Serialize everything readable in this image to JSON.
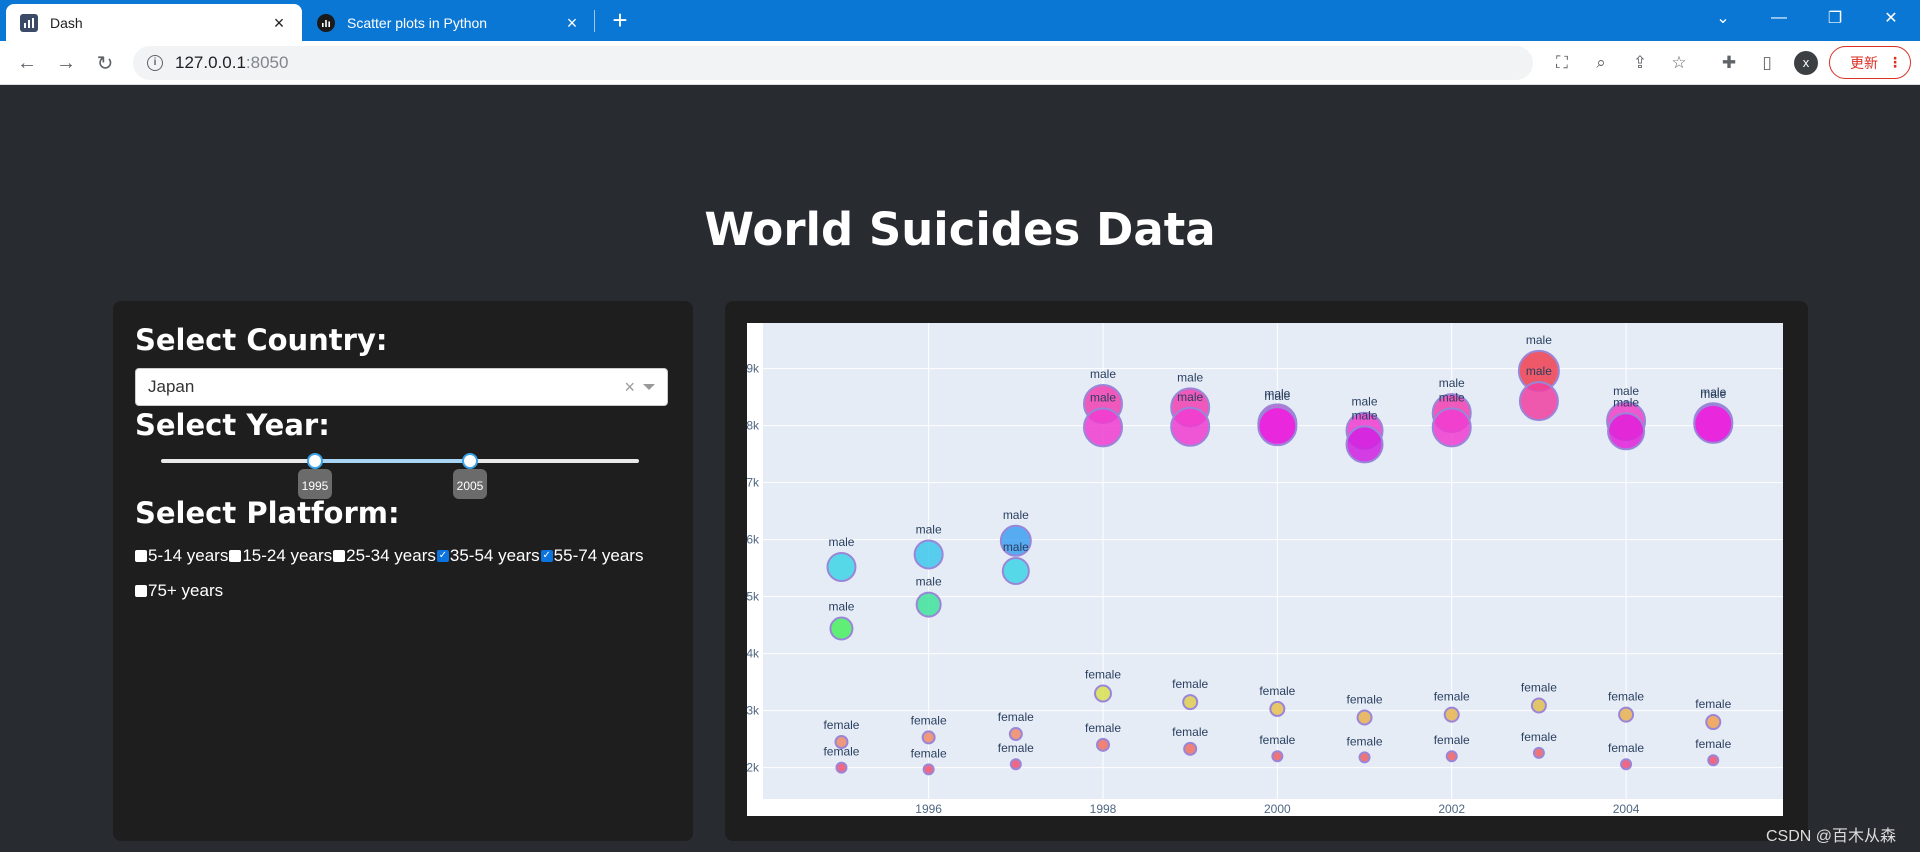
{
  "browser": {
    "tabs": [
      {
        "title": "Dash",
        "active": true
      },
      {
        "title": "Scatter plots in Python",
        "active": false
      }
    ],
    "url_host": "127.0.0.1",
    "url_port": ":8050",
    "profile_initial": "x",
    "update_label": "更新"
  },
  "app": {
    "title": "World Suicides Data",
    "country_label": "Select Country:",
    "country_value": "Japan",
    "year_label": "Select Year:",
    "year_range": [
      1995,
      2005
    ],
    "year_range_labels": [
      "1995",
      "2005"
    ],
    "platform_label": "Select Platform:",
    "age_groups": [
      {
        "label": "5-14 years",
        "checked": false
      },
      {
        "label": "15-24 years",
        "checked": false
      },
      {
        "label": "25-34 years",
        "checked": false
      },
      {
        "label": "35-54 years",
        "checked": true
      },
      {
        "label": "55-74 years",
        "checked": true
      },
      {
        "label": "75+ years",
        "checked": false
      }
    ]
  },
  "chart_data": {
    "type": "scatter",
    "xlim": [
      1994.1,
      2005.8
    ],
    "ylim": [
      1450,
      9800
    ],
    "xticks": [
      1996,
      1998,
      2000,
      2002,
      2004
    ],
    "yticks": [
      2000,
      3000,
      4000,
      5000,
      6000,
      7000,
      8000,
      9000
    ],
    "ytick_labels": [
      "2k",
      "3k",
      "4k",
      "5k",
      "6k",
      "7k",
      "8k",
      "9k"
    ],
    "grid": true,
    "points": [
      {
        "x": 1995,
        "y": 5520,
        "label": "male",
        "r": 14,
        "color": "#3ed5e6"
      },
      {
        "x": 1995,
        "y": 4440,
        "label": "male",
        "r": 11,
        "color": "#48f060"
      },
      {
        "x": 1995,
        "y": 2450,
        "label": "female",
        "r": 6,
        "color": "#f08a66"
      },
      {
        "x": 1995,
        "y": 2000,
        "label": "female",
        "r": 5,
        "color": "#f05070"
      },
      {
        "x": 1996,
        "y": 5740,
        "label": "male",
        "r": 14,
        "color": "#3ec8ec"
      },
      {
        "x": 1996,
        "y": 4860,
        "label": "male",
        "r": 12,
        "color": "#40e39a"
      },
      {
        "x": 1996,
        "y": 2530,
        "label": "female",
        "r": 6,
        "color": "#f08a66"
      },
      {
        "x": 1996,
        "y": 1970,
        "label": "female",
        "r": 5,
        "color": "#f05070"
      },
      {
        "x": 1997,
        "y": 5980,
        "label": "male",
        "r": 15,
        "color": "#3ea0f0"
      },
      {
        "x": 1997,
        "y": 5450,
        "label": "male",
        "r": 13,
        "color": "#3ed5e6"
      },
      {
        "x": 1997,
        "y": 2590,
        "label": "female",
        "r": 6,
        "color": "#f08a66"
      },
      {
        "x": 1997,
        "y": 2060,
        "label": "female",
        "r": 5,
        "color": "#f05070"
      },
      {
        "x": 1998,
        "y": 8380,
        "label": "male",
        "r": 19,
        "color": "#f040b0"
      },
      {
        "x": 1998,
        "y": 7970,
        "label": "male",
        "r": 19,
        "color": "#f03cd0"
      },
      {
        "x": 1998,
        "y": 3300,
        "label": "female",
        "r": 8,
        "color": "#d8e050"
      },
      {
        "x": 1998,
        "y": 2400,
        "label": "female",
        "r": 6,
        "color": "#f07060"
      },
      {
        "x": 1999,
        "y": 8320,
        "label": "male",
        "r": 19,
        "color": "#f040b0"
      },
      {
        "x": 1999,
        "y": 7980,
        "label": "male",
        "r": 19,
        "color": "#f03cd0"
      },
      {
        "x": 1999,
        "y": 3150,
        "label": "female",
        "r": 7,
        "color": "#e0cc50"
      },
      {
        "x": 1999,
        "y": 2330,
        "label": "female",
        "r": 6,
        "color": "#f07060"
      },
      {
        "x": 2000,
        "y": 8040,
        "label": "male",
        "r": 19,
        "color": "#f03cc0"
      },
      {
        "x": 2000,
        "y": 7990,
        "label": "male",
        "r": 19,
        "color": "#e81ee0"
      },
      {
        "x": 2000,
        "y": 3030,
        "label": "female",
        "r": 7,
        "color": "#e8c050"
      },
      {
        "x": 2000,
        "y": 2200,
        "label": "female",
        "r": 5,
        "color": "#f06060"
      },
      {
        "x": 2001,
        "y": 7910,
        "label": "male",
        "r": 18,
        "color": "#f03cd0"
      },
      {
        "x": 2001,
        "y": 7670,
        "label": "male",
        "r": 18,
        "color": "#d020e0"
      },
      {
        "x": 2001,
        "y": 2880,
        "label": "female",
        "r": 7,
        "color": "#e8b050"
      },
      {
        "x": 2001,
        "y": 2180,
        "label": "female",
        "r": 5,
        "color": "#f06060"
      },
      {
        "x": 2002,
        "y": 8220,
        "label": "male",
        "r": 19,
        "color": "#f040b0"
      },
      {
        "x": 2002,
        "y": 7970,
        "label": "male",
        "r": 19,
        "color": "#f03cd0"
      },
      {
        "x": 2002,
        "y": 2930,
        "label": "female",
        "r": 7,
        "color": "#e8b450"
      },
      {
        "x": 2002,
        "y": 2200,
        "label": "female",
        "r": 5,
        "color": "#f06060"
      },
      {
        "x": 2003,
        "y": 8960,
        "label": "male",
        "r": 20,
        "color": "#f04050"
      },
      {
        "x": 2003,
        "y": 8430,
        "label": "male",
        "r": 19,
        "color": "#f040a0"
      },
      {
        "x": 2003,
        "y": 3090,
        "label": "female",
        "r": 7,
        "color": "#e0c050"
      },
      {
        "x": 2003,
        "y": 2260,
        "label": "female",
        "r": 5,
        "color": "#f06060"
      },
      {
        "x": 2004,
        "y": 8080,
        "label": "male",
        "r": 19,
        "color": "#f040c8"
      },
      {
        "x": 2004,
        "y": 7900,
        "label": "male",
        "r": 18,
        "color": "#e020d8"
      },
      {
        "x": 2004,
        "y": 2930,
        "label": "female",
        "r": 7,
        "color": "#e8b050"
      },
      {
        "x": 2004,
        "y": 2060,
        "label": "female",
        "r": 5,
        "color": "#f05070"
      },
      {
        "x": 2005,
        "y": 8060,
        "label": "male",
        "r": 19,
        "color": "#f03cc0"
      },
      {
        "x": 2005,
        "y": 8030,
        "label": "male",
        "r": 19,
        "color": "#e81ee0"
      },
      {
        "x": 2005,
        "y": 2800,
        "label": "female",
        "r": 7,
        "color": "#f0a050"
      },
      {
        "x": 2005,
        "y": 2130,
        "label": "female",
        "r": 5,
        "color": "#f05070"
      }
    ]
  },
  "watermark": "CSDN @百木从森"
}
